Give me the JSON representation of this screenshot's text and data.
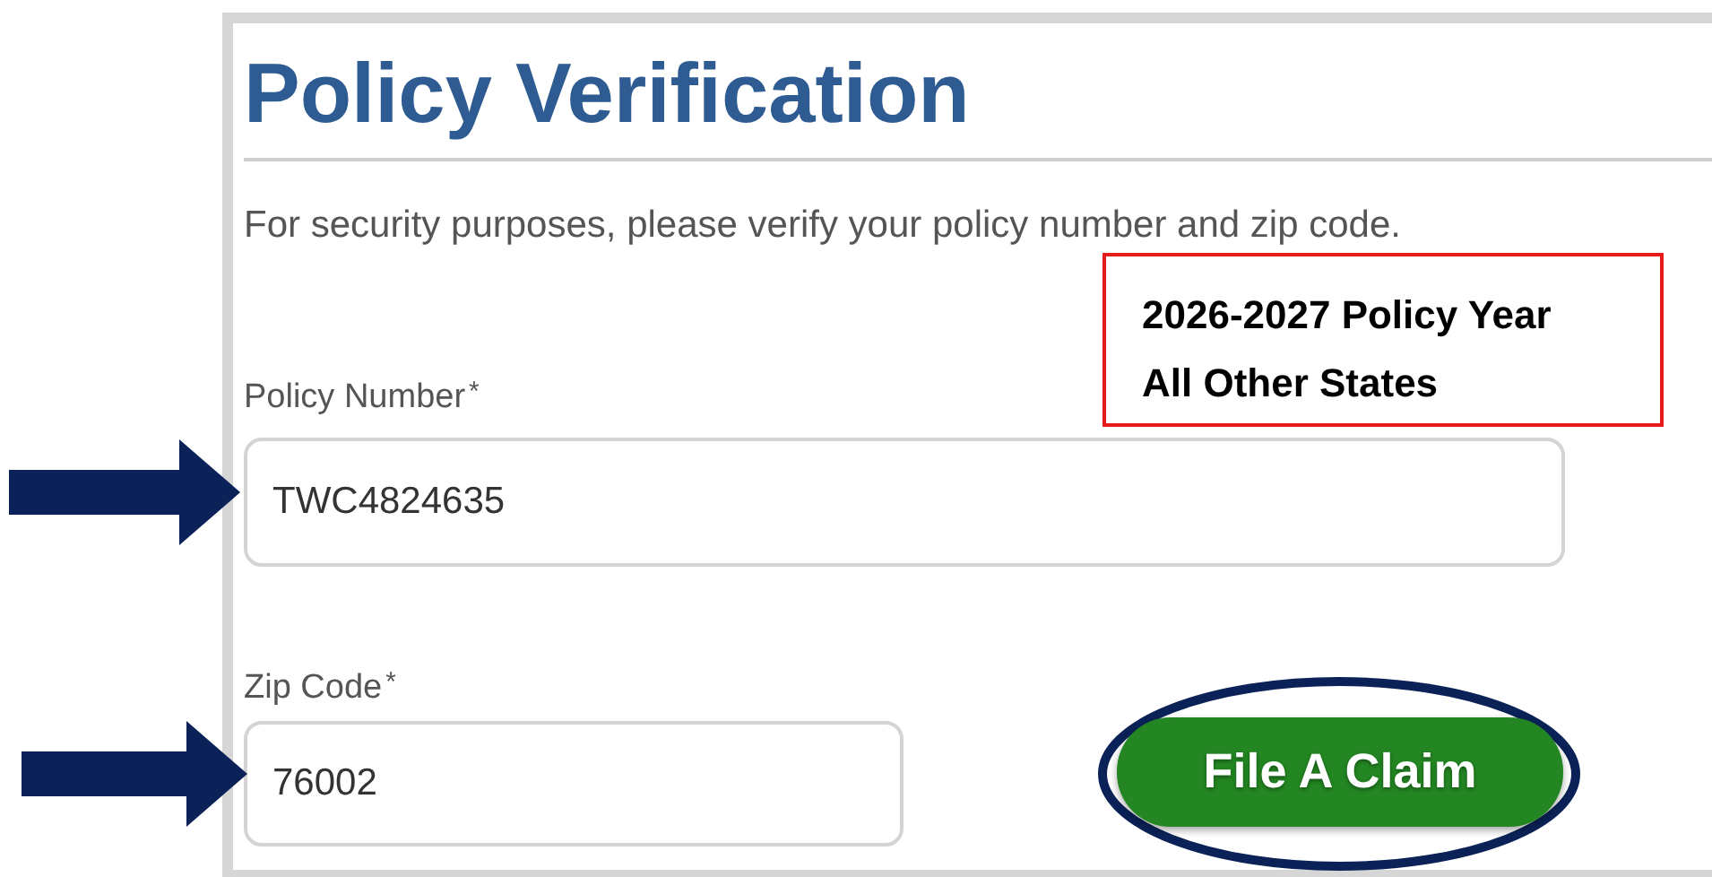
{
  "heading": "Policy Verification",
  "instructions": "For security purposes, please verify your policy number and zip code.",
  "callout": {
    "lines": [
      "2026-2027 Policy Year",
      "All Other States"
    ]
  },
  "fields": [
    {
      "label": "Policy Number",
      "required_mark": "*",
      "value": "TWC4824635"
    },
    {
      "label": "Zip Code",
      "required_mark": "*",
      "value": "76002"
    }
  ],
  "submit_button": {
    "label": "File A Claim",
    "circled": true
  }
}
